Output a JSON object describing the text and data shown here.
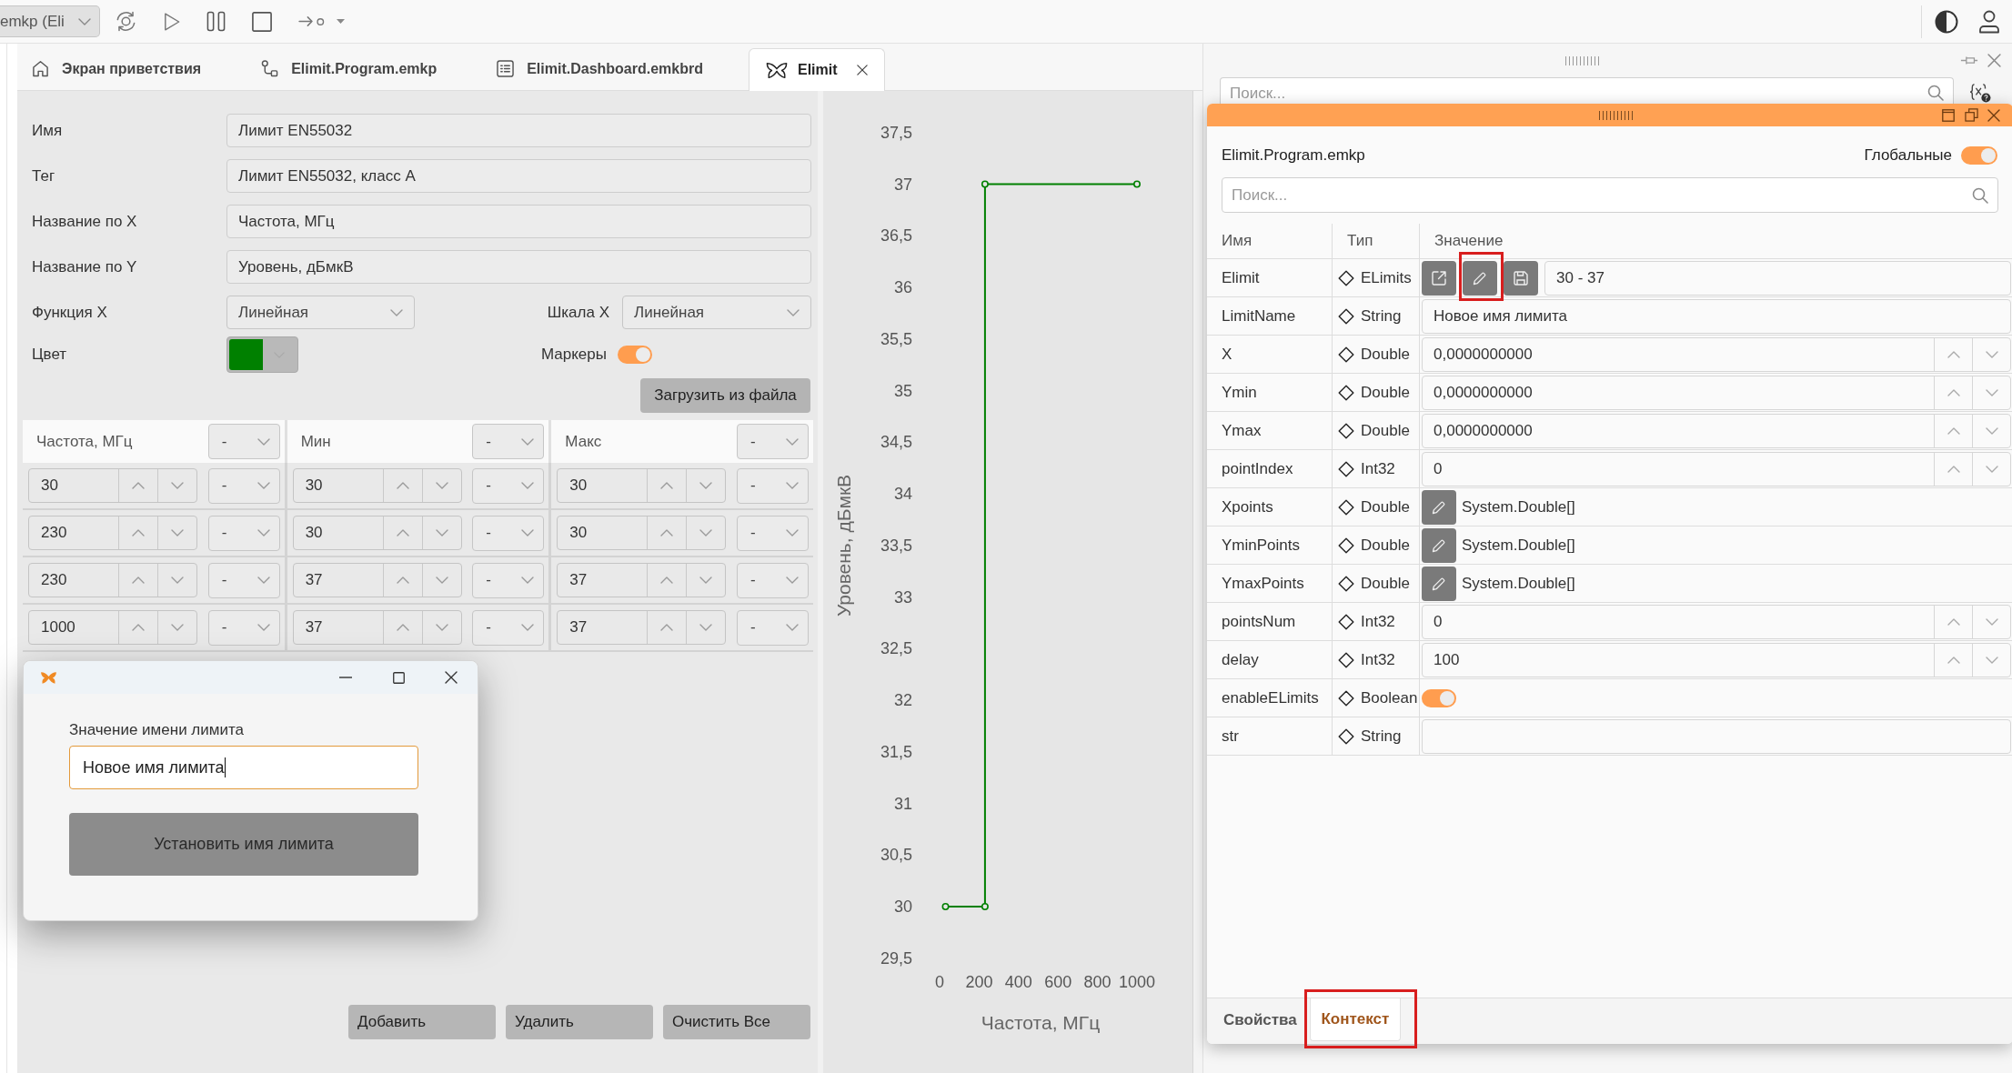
{
  "toolbar": {
    "project_selector": {
      "value": "emkp (Eli"
    }
  },
  "tabs": [
    {
      "label": "Экран приветствия",
      "kind": "home",
      "selected": false
    },
    {
      "label": "Elimit.Program.emkp",
      "kind": "program",
      "selected": false
    },
    {
      "label": "Elimit.Dashboard.emkbrd",
      "kind": "dashboard",
      "selected": false
    },
    {
      "label": "Elimit",
      "kind": "limit",
      "selected": true
    }
  ],
  "limit_form": {
    "fields": [
      {
        "label": "Имя",
        "value": "Лимит EN55032"
      },
      {
        "label": "Тег",
        "value": "Лимит EN55032, класс A"
      },
      {
        "label": "Название по X",
        "value": "Частота, МГц"
      },
      {
        "label": "Название по Y",
        "value": "Уровень, дБмкВ"
      }
    ],
    "function_x": {
      "label": "Функция X",
      "value": "Линейная"
    },
    "scale_x": {
      "label": "Шкала X",
      "value": "Линейная"
    },
    "color": {
      "label": "Цвет",
      "color": "#008000"
    },
    "markers": {
      "label": "Маркеры",
      "on": true
    },
    "load_button": "Загрузить из файла"
  },
  "points_table": {
    "columns": [
      {
        "label": "Частота, МГц",
        "unit": "-"
      },
      {
        "label": "Мин",
        "unit": "-"
      },
      {
        "label": "Макс",
        "unit": "-"
      }
    ],
    "rows": [
      {
        "cells": [
          {
            "value": "30",
            "unit": "-"
          },
          {
            "value": "30",
            "unit": "-"
          },
          {
            "value": "30",
            "unit": "-"
          }
        ]
      },
      {
        "cells": [
          {
            "value": "230",
            "unit": "-"
          },
          {
            "value": "30",
            "unit": "-"
          },
          {
            "value": "30",
            "unit": "-"
          }
        ]
      },
      {
        "cells": [
          {
            "value": "230",
            "unit": "-"
          },
          {
            "value": "37",
            "unit": "-"
          },
          {
            "value": "37",
            "unit": "-"
          }
        ]
      },
      {
        "cells": [
          {
            "value": "1000",
            "unit": "-"
          },
          {
            "value": "37",
            "unit": "-"
          },
          {
            "value": "37",
            "unit": "-"
          }
        ]
      }
    ]
  },
  "actions": [
    {
      "label": "Добавить"
    },
    {
      "label": "Удалить"
    },
    {
      "label": "Очистить Все"
    }
  ],
  "chart": {
    "chart_data": {
      "type": "line",
      "xlabel": "Частота, МГц",
      "ylabel": "Уровень, дБмкВ",
      "x": [
        30,
        230,
        230,
        1000
      ],
      "series": [
        {
          "color": "#008000",
          "marker": "circle",
          "values": [
            30,
            30,
            37,
            37
          ]
        }
      ],
      "xlim": [
        0,
        1000
      ],
      "ylim": [
        29.5,
        37.5
      ],
      "xticks": [
        0,
        200,
        400,
        600,
        800,
        1000
      ],
      "yticks": [
        {
          "value": 29.5,
          "label": "29,5"
        },
        30,
        {
          "value": 30.5,
          "label": "30,5"
        },
        31,
        {
          "value": 31.5,
          "label": "31,5"
        },
        32,
        {
          "value": 32.5,
          "label": "32,5"
        },
        33,
        {
          "value": 33.5,
          "label": "33,5"
        },
        34,
        {
          "value": 34.5,
          "label": "34,5"
        },
        35,
        {
          "value": 35.5,
          "label": "35,5"
        },
        36,
        {
          "value": 36.5,
          "label": "36,5"
        },
        37,
        {
          "value": 37.5,
          "label": "37,5"
        }
      ]
    }
  },
  "dialog": {
    "label": "Значение имени лимита",
    "input": {
      "value": "Новое имя лимита",
      "focused": true
    },
    "button": "Установить имя лимита"
  },
  "side_panel": {
    "search": {
      "placeholder": "Поиск..."
    }
  },
  "variables_window": {
    "title": "Elimit.Program.emkp",
    "global_toggle": {
      "label": "Глобальные",
      "on": true
    },
    "search": {
      "placeholder": "Поиск..."
    },
    "columns": [
      "Имя",
      "Тип",
      "Значение"
    ],
    "rows": [
      {
        "name": "Elimit",
        "type": "ELimits",
        "kind": "object",
        "buttons": [
          {
            "kind": "open",
            "annotated": false
          },
          {
            "kind": "edit",
            "annotated": true
          },
          {
            "kind": "save",
            "annotated": false
          }
        ],
        "value": "30 - 37"
      },
      {
        "name": "LimitName",
        "type": "String",
        "kind": "text",
        "value": "Новое имя лимита"
      },
      {
        "name": "X",
        "type": "Double",
        "kind": "number",
        "value": "0,0000000000"
      },
      {
        "name": "Ymin",
        "type": "Double",
        "kind": "number",
        "value": "0,0000000000"
      },
      {
        "name": "Ymax",
        "type": "Double",
        "kind": "number",
        "value": "0,0000000000"
      },
      {
        "name": "pointIndex",
        "type": "Int32",
        "kind": "number",
        "value": "0"
      },
      {
        "name": "Xpoints",
        "type": "Double",
        "kind": "array",
        "value": "System.Double[]"
      },
      {
        "name": "YminPoints",
        "type": "Double",
        "kind": "array",
        "value": "System.Double[]"
      },
      {
        "name": "YmaxPoints",
        "type": "Double",
        "kind": "array",
        "value": "System.Double[]"
      },
      {
        "name": "pointsNum",
        "type": "Int32",
        "kind": "number",
        "value": "0"
      },
      {
        "name": "delay",
        "type": "Int32",
        "kind": "number",
        "value": "100"
      },
      {
        "name": "enableELimits",
        "type": "Boolean",
        "kind": "boolean",
        "on": true
      },
      {
        "name": "str",
        "type": "String",
        "kind": "text"
      }
    ],
    "bottom_tabs": [
      {
        "label": "Свойства",
        "selected": false,
        "annotated": false
      },
      {
        "label": "Контекст",
        "selected": true,
        "annotated": true
      }
    ]
  }
}
